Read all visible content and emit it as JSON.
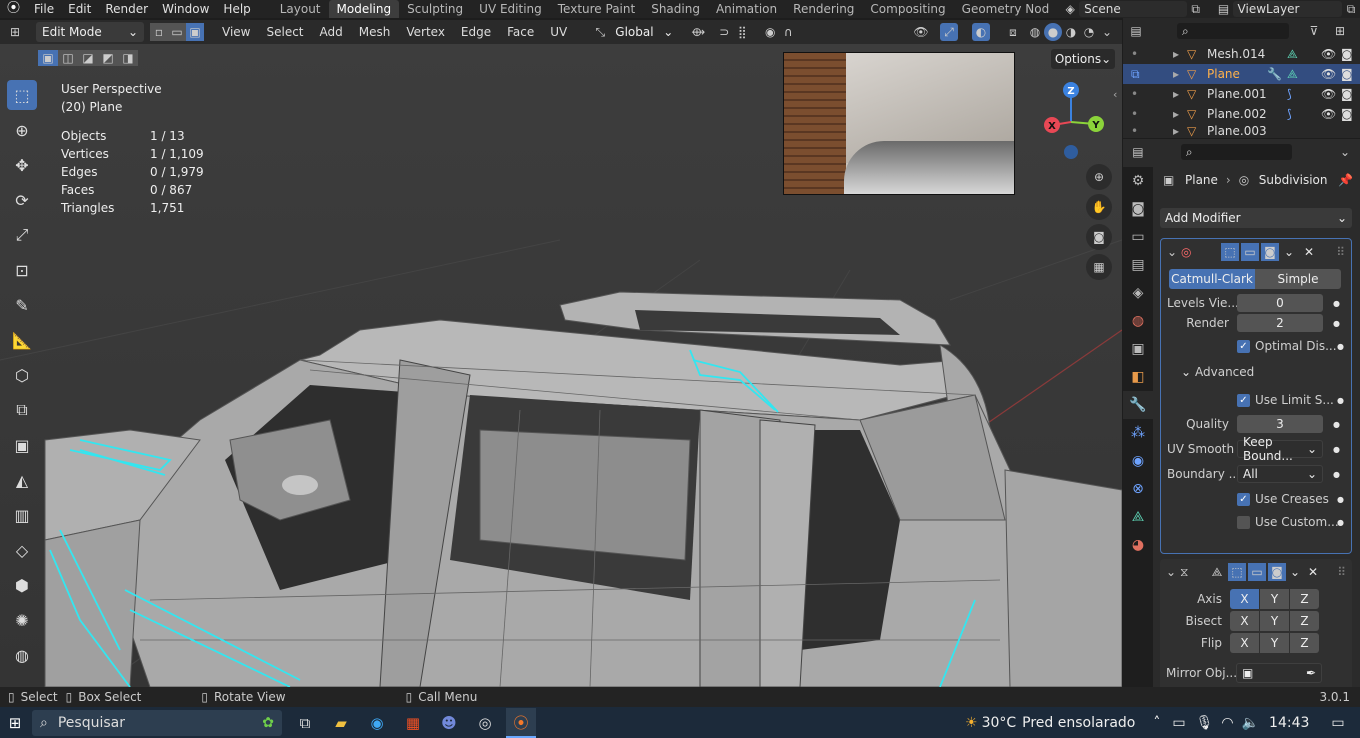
{
  "menu": {
    "items": [
      "File",
      "Edit",
      "Render",
      "Window",
      "Help"
    ]
  },
  "workspaces": {
    "tabs": [
      "Layout",
      "Modeling",
      "Sculpting",
      "UV Editing",
      "Texture Paint",
      "Shading",
      "Animation",
      "Rendering",
      "Compositing",
      "Geometry Nod"
    ],
    "active": "Modeling"
  },
  "scene": {
    "name": "Scene",
    "viewlayer": "ViewLayer"
  },
  "viewport_header": {
    "mode": "Edit Mode",
    "menus": [
      "View",
      "Select",
      "Add",
      "Mesh",
      "Vertex",
      "Edge",
      "Face",
      "UV"
    ],
    "transform_orientation": "Global",
    "options_label": "Options"
  },
  "viewport": {
    "view_name": "User Perspective",
    "object_label": "(20) Plane",
    "stats": [
      {
        "label": "Objects",
        "value": "1 / 13"
      },
      {
        "label": "Vertices",
        "value": "1 / 1,109"
      },
      {
        "label": "Edges",
        "value": "0 / 1,979"
      },
      {
        "label": "Faces",
        "value": "0 / 867"
      },
      {
        "label": "Triangles",
        "value": "1,751"
      }
    ],
    "gizmo": {
      "x": "X",
      "y": "Y",
      "z": "Z"
    },
    "colors": {
      "axis_x": "#e84855",
      "axis_y": "#8bd33a",
      "axis_z": "#3b82e0",
      "selected_edge": "#33e6f0",
      "mesh": "#a7a7a7"
    }
  },
  "outliner": {
    "items": [
      {
        "name": "Mesh.014",
        "selected": false
      },
      {
        "name": "Plane",
        "selected": true
      },
      {
        "name": "Plane.001",
        "selected": false
      },
      {
        "name": "Plane.002",
        "selected": false
      },
      {
        "name": "Plane.003",
        "selected": false
      }
    ]
  },
  "properties": {
    "breadcrumb_object": "Plane",
    "breadcrumb_modifier": "Subdivision",
    "add_modifier": "Add Modifier",
    "subdivision": {
      "type_a": "Catmull-Clark",
      "type_b": "Simple",
      "levels_label": "Levels Vie...",
      "levels_value": "0",
      "render_label": "Render",
      "render_value": "2",
      "optimal_label": "Optimal Dis...",
      "advanced_label": "Advanced",
      "use_limit_label": "Use Limit S...",
      "quality_label": "Quality",
      "quality_value": "3",
      "uv_smooth_label": "UV Smooth",
      "uv_smooth_value": "Keep Bound...",
      "boundary_label": "Boundary ...",
      "boundary_value": "All",
      "use_creases_label": "Use Creases",
      "use_custom_label": "Use Custom..."
    },
    "mirror": {
      "axis_label": "Axis",
      "bisect_label": "Bisect",
      "flip_label": "Flip",
      "mirror_obj_label": "Mirror Obj...",
      "axes": [
        "X",
        "Y",
        "Z"
      ]
    }
  },
  "statusbar": {
    "select": "Select",
    "box_select": "Box Select",
    "rotate": "Rotate View",
    "call_menu": "Call Menu",
    "version": "3.0.1"
  },
  "taskbar": {
    "search_placeholder": "Pesquisar",
    "weather_temp": "30°C",
    "weather_text": "Pred ensolarado",
    "time": "14:43"
  }
}
